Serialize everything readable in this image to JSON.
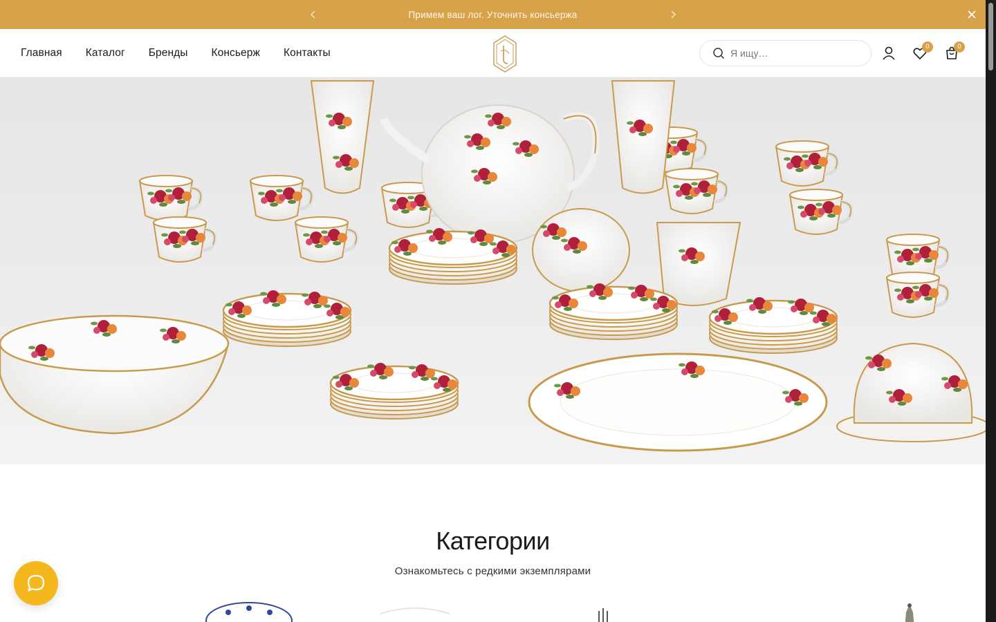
{
  "announcement": {
    "text": "Примем ваш лог. Уточнить консьержа"
  },
  "nav": {
    "items": [
      "Главная",
      "Каталог",
      "Бренды",
      "Консьерж",
      "Контакты"
    ]
  },
  "search": {
    "placeholder": "Я ищу…"
  },
  "header_icons": {
    "wishlist_count": "0",
    "cart_count": "0"
  },
  "hero": {
    "image": "porcelain-tea-set-with-roses"
  },
  "categories": {
    "title": "Категории",
    "subtitle": "Ознакомьтесь с редкими экземплярами"
  },
  "colors": {
    "accent": "#d8a24a",
    "chat_button": "#f4b81e",
    "rose_red": "#b0203a",
    "rose_orange": "#e8863a",
    "gold_rim": "#c89a4c"
  }
}
